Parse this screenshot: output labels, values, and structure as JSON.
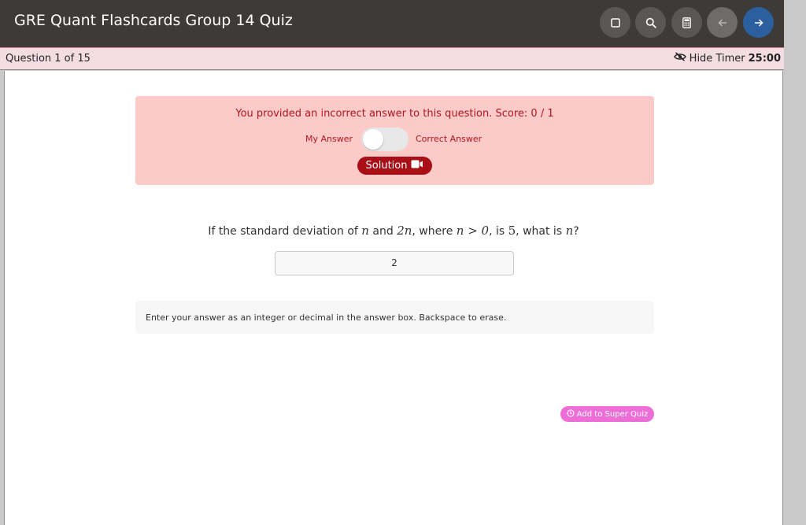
{
  "header": {
    "title": "GRE Quant Flashcards Group 14 Quiz",
    "buttons": [
      {
        "name": "square-icon"
      },
      {
        "name": "search-icon"
      },
      {
        "name": "calculator-icon"
      },
      {
        "name": "arrow-left-icon"
      },
      {
        "name": "arrow-right-icon"
      }
    ]
  },
  "qbar": {
    "question_count": "Question 1 of 15",
    "hide_timer_label": "Hide Timer",
    "timer_value": "25:00"
  },
  "feedback": {
    "message": "You provided an incorrect answer to this question. Score: 0 / 1",
    "my_answer_label": "My Answer",
    "correct_answer_label": "Correct Answer",
    "solution_label": "Solution"
  },
  "question": {
    "part1": "If the standard deviation of",
    "var_n": "n",
    "part2": "and",
    "term_2n": "2n",
    "part3": ", where",
    "cond": "n > 0",
    "part4": ", is",
    "value": "5",
    "part5": ", what is",
    "part6": "?"
  },
  "answer": {
    "value": "2"
  },
  "hint": {
    "text": "Enter your answer as an integer or decimal in the answer box. Backspace to erase."
  },
  "super_quiz": {
    "label": "Add to Super Quiz"
  },
  "colors": {
    "header_bg": "#3d3a38",
    "alert_bg": "#fdcaca",
    "alert_text": "#b0161d",
    "solution_bg": "#a80f17",
    "super_quiz_bg": "#ee6ed8",
    "next_button_bg": "#2b5f9e"
  }
}
